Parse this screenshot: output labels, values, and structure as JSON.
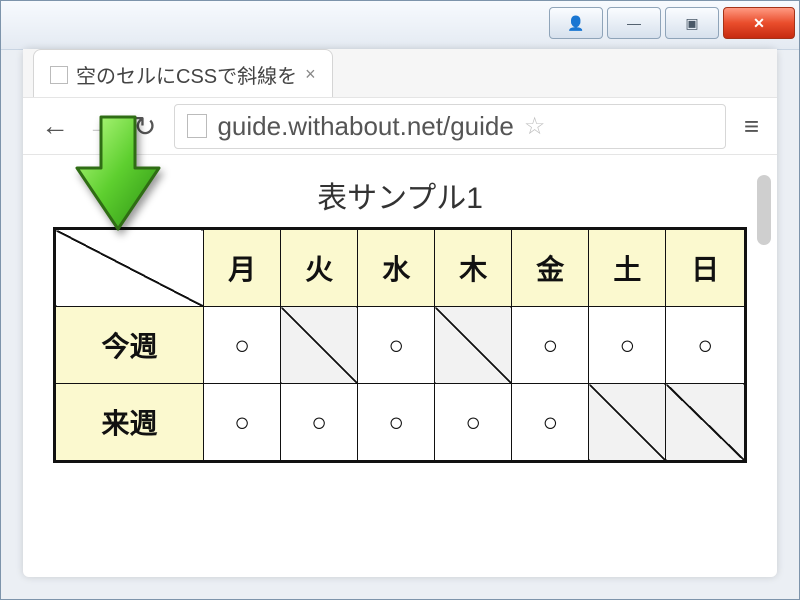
{
  "window": {
    "user_btn": "👤",
    "min_btn": "—",
    "max_btn": "▣",
    "close_btn": "✕"
  },
  "browser": {
    "tab_title": "空のセルにCSSで斜線を",
    "tab_close": "×",
    "back": "←",
    "forward": "→",
    "reload": "↻",
    "url": "guide.withabout.net/guide",
    "star": "☆",
    "menu": "≡"
  },
  "page": {
    "caption": "表サンプル1",
    "headers": [
      "",
      "月",
      "火",
      "水",
      "木",
      "金",
      "土",
      "日"
    ],
    "rows": [
      {
        "label": "今週",
        "cells": [
          {
            "v": "○",
            "d": false
          },
          {
            "v": "",
            "d": true,
            "shade": true
          },
          {
            "v": "○",
            "d": false
          },
          {
            "v": "",
            "d": true,
            "shade": true
          },
          {
            "v": "○",
            "d": false
          },
          {
            "v": "○",
            "d": false
          },
          {
            "v": "○",
            "d": false
          }
        ]
      },
      {
        "label": "来週",
        "cells": [
          {
            "v": "○",
            "d": false
          },
          {
            "v": "○",
            "d": false
          },
          {
            "v": "○",
            "d": false
          },
          {
            "v": "○",
            "d": false
          },
          {
            "v": "○",
            "d": false
          },
          {
            "v": "",
            "d": true,
            "shade": true
          },
          {
            "v": "",
            "d": true,
            "shade": true
          }
        ]
      }
    ]
  }
}
